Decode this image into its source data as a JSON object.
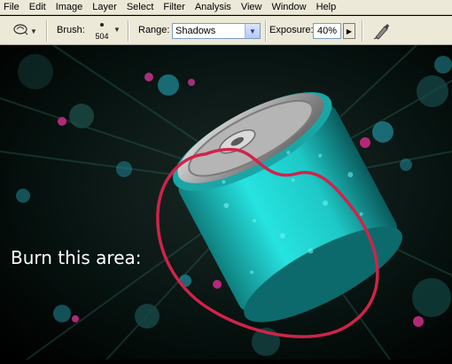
{
  "menubar": {
    "items": [
      "File",
      "Edit",
      "Image",
      "Layer",
      "Select",
      "Filter",
      "Analysis",
      "View",
      "Window",
      "Help"
    ]
  },
  "options": {
    "brush_label": "Brush:",
    "brush_size": "504",
    "range_label": "Range:",
    "range_value": "Shadows",
    "exposure_label": "Exposure:",
    "exposure_value": "40%"
  },
  "canvas": {
    "caption": "Burn this area:",
    "colors": {
      "can": "#1fd4d2",
      "circle_annotation": "#d0234a",
      "accent_magenta": "#b3287a",
      "background": "#06120f"
    }
  },
  "icons": {
    "tool_preset": "burn-tool-icon",
    "airbrush": "airbrush-icon"
  }
}
